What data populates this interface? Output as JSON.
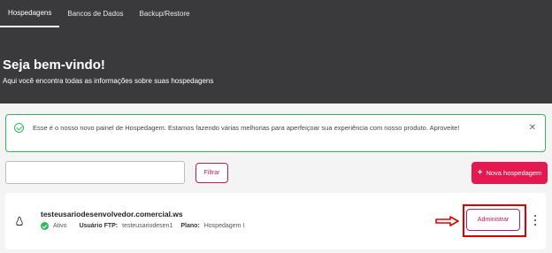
{
  "nav": {
    "tabs": [
      {
        "label": "Hospedagens"
      },
      {
        "label": "Bancos de Dados"
      },
      {
        "label": "Backup/Restore"
      }
    ]
  },
  "hero": {
    "title": "Seja bem-vindo!",
    "subtitle": "Aqui você encontra todas as informações sobre suas hospedagens"
  },
  "notice": {
    "text": "Esse é o nosso novo painel de Hospedagem. Estamos fazendo várias melhorias para aperfeiçoar sua experiência com nosso produto. Aproveite!",
    "close_symbol": "✕"
  },
  "toolbar": {
    "search_value": "",
    "filter_label": "Filtrar",
    "new_label": "Nova hospedagem",
    "new_plus": "+"
  },
  "hosting": {
    "domain": "testeusariodesenvolvedor.comercial.ws",
    "status": "Ativo",
    "ftp_label": "Usuário FTP:",
    "ftp_value": "testeusariodesen1",
    "plan_label": "Plano:",
    "plan_value": "Hospedagem I",
    "admin_label": "Administrar"
  },
  "colors": {
    "header_bg": "#3a3a3c",
    "accent": "#e5194f",
    "success": "#2eb85c",
    "highlight": "#e00000"
  },
  "icons": [
    "check-circle-icon",
    "close-icon",
    "linux-icon",
    "status-check-icon",
    "arrow-right-icon",
    "kebab-menu-icon"
  ]
}
